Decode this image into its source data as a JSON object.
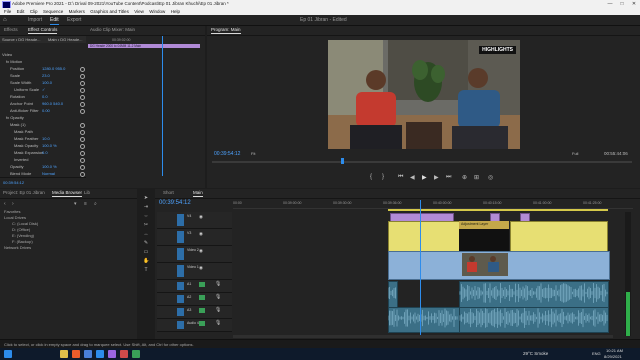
{
  "window": {
    "title": "Adobe Premiere Pro 2021 - D:\\ Drival 09-2021\\YouTube Content\\Podcast\\Ep 01 Jibran Khuchi\\Ep 01 Jibran *",
    "minimize": "—",
    "maximize": "□",
    "close": "✕"
  },
  "menu": [
    "File",
    "Edit",
    "Clip",
    "Sequence",
    "Markers",
    "Graphics and Titles",
    "View",
    "Window",
    "Help"
  ],
  "workspaces": {
    "home": "Home",
    "import": "Import",
    "edit": "Edit",
    "export": "Export",
    "project_title": "Ep 01 Jibran - Edited"
  },
  "effect_panel": {
    "tabs": [
      "Effects",
      "Effect Controls",
      "Audio Clip Mixer: Main"
    ],
    "source_label": "Source • DG Heade... ",
    "seq_label": "Main • DG Heade...",
    "ruler_time": "00:39:02:00",
    "clip_bar_label": "DG Heade 2000 to 04MM 11-2 Main",
    "sections": [
      {
        "label": "Video",
        "value": "",
        "indent": 0
      },
      {
        "label": "fx Motion",
        "value": "",
        "indent": 1
      },
      {
        "label": "Position",
        "value": "1280.0   955.0",
        "indent": 2
      },
      {
        "label": "Scale",
        "value": "23.0",
        "indent": 2
      },
      {
        "label": "Scale Width",
        "value": "100.0",
        "indent": 2
      },
      {
        "label": "Uniform Scale",
        "value": "✓",
        "indent": 3
      },
      {
        "label": "Rotation",
        "value": "0.0",
        "indent": 2
      },
      {
        "label": "Anchor Point",
        "value": "960.0   540.0",
        "indent": 2
      },
      {
        "label": "Anti-flicker Filter",
        "value": "0.00",
        "indent": 2
      },
      {
        "label": "fx Opacity",
        "value": "",
        "indent": 1
      },
      {
        "label": "Mask (1)",
        "value": "",
        "indent": 2
      },
      {
        "label": "Mask Path",
        "value": "",
        "indent": 3
      },
      {
        "label": "Mask Feather",
        "value": "10.0",
        "indent": 3
      },
      {
        "label": "Mask Opacity",
        "value": "100.0 %",
        "indent": 3
      },
      {
        "label": "Mask Expansion",
        "value": "0.0",
        "indent": 3
      },
      {
        "label": "Inverted",
        "value": "",
        "indent": 3
      },
      {
        "label": "Opacity",
        "value": "100.0 %",
        "indent": 2
      },
      {
        "label": "Blend Mode",
        "value": "Normal",
        "indent": 2
      }
    ],
    "timecode": "00:39:54:12"
  },
  "program": {
    "tab": "Program: Main",
    "badge": "HIGHLIGHTS",
    "timecode": "00:39:54:12",
    "fit": "Fit",
    "quality": "Full",
    "duration": "00:55:44:06"
  },
  "project_panel": {
    "tabs": [
      "Project: Ep 01 Jibran",
      "Media Browser",
      "Lib"
    ],
    "tree": [
      {
        "label": "Favorites",
        "indent": 0
      },
      {
        "label": "Local Drives",
        "indent": 0
      },
      {
        "label": "C: (Local Disk)",
        "indent": 1
      },
      {
        "label": "D: (Office)",
        "indent": 1
      },
      {
        "label": "E: (Vending)",
        "indent": 1
      },
      {
        "label": "F: (Backup)",
        "indent": 1
      },
      {
        "label": "Network Drives",
        "indent": 0
      }
    ]
  },
  "timeline": {
    "tabs": [
      "Short",
      "Main"
    ],
    "timecode": "00:39:54:12",
    "ruler": [
      "00:00",
      "00:39:00:00",
      "00:39:30:00",
      "00:39:36:00",
      "00:40:00:00",
      "00:40:15:00",
      "00:41:00:00",
      "00:41:25:00"
    ],
    "video_tracks": [
      "V4",
      "V3",
      "Video 2",
      "Video 1"
    ],
    "audio_tracks": [
      "A1",
      "A2",
      "A3",
      "Audio 4"
    ],
    "clip_labels": {
      "adjustment": "Adjustment Layer",
      "fx": "fx"
    }
  },
  "status_bar": {
    "text": "Click to select, or click in empty space and drag to marquee select. Use Shift, Alt, and Ctrl for other options."
  },
  "taskbar": {
    "weather": "29°C Smoke",
    "time": "10:21 AM",
    "date": "8/29/2021",
    "lang": "ENG"
  },
  "colors": {
    "accent": "#2d8ceb",
    "clip_yellow": "#e7df73",
    "clip_blue": "#8cb1d8",
    "clip_audio": "#3b6f86",
    "clip_pink": "#b28bd6",
    "playhead": "#2d8ceb"
  }
}
